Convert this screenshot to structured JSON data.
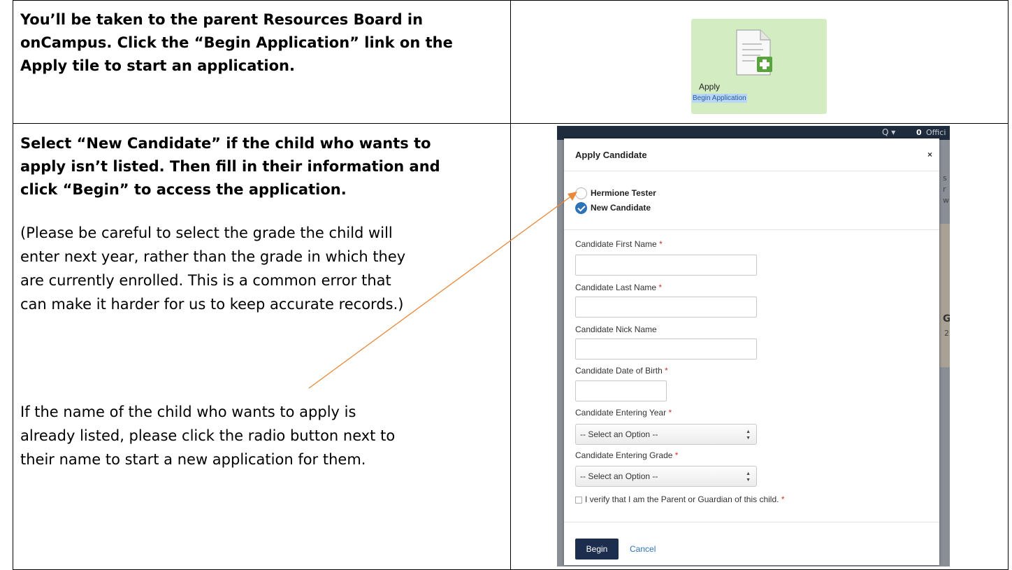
{
  "step1": {
    "instruction": [
      "You’ll be taken to the parent Resources Board in",
      "onCampus. Click the “Begin Application” link on the",
      "Apply tile to start an application."
    ],
    "tile": {
      "label": "Apply",
      "link": "Begin Application",
      "icon": "document-plus-icon",
      "color": "#d4ecc1"
    }
  },
  "step2": {
    "instruction": [
      "Select “New Candidate” if the child who wants to",
      "apply isn’t listed. Then fill in their information and",
      "click “Begin” to access the application."
    ],
    "note": [
      "(Please be careful to select the grade the child will",
      "enter next year, rather than the grade in which they",
      "are currently enrolled. This is a common error that",
      "can make it harder for us to keep accurate records.)"
    ],
    "tip": [
      "If the name of the child who wants to apply is",
      "already listed, please click the radio button next to",
      "their name to start a new application for them."
    ]
  },
  "screenshot": {
    "topbar": {
      "search": "Q ▾",
      "count": "0",
      "officials": "Offici"
    },
    "bg_chars": {
      "s": "s",
      "r": "r",
      "w": "w",
      "g": "G",
      "two": "2"
    },
    "modal": {
      "title": "Apply Candidate",
      "close": "×",
      "candidates": [
        {
          "name": "Hermione Tester",
          "selected": false
        },
        {
          "name": "New Candidate",
          "selected": true
        }
      ],
      "fields": {
        "first_name": "Candidate First Name",
        "last_name": "Candidate Last Name",
        "nick_name": "Candidate Nick Name",
        "dob": "Candidate Date of Birth",
        "entering_year": "Candidate Entering Year",
        "entering_grade": "Candidate Entering Grade"
      },
      "required_mark": "*",
      "select_placeholder": "-- Select an Option --",
      "verify_text": "I verify that I am the Parent or Guardian of this child.",
      "begin": "Begin",
      "cancel": "Cancel"
    }
  },
  "colors": {
    "accent": "#2d73b6",
    "arrow": "#e8883a",
    "begin_button": "#1c2d4e"
  }
}
